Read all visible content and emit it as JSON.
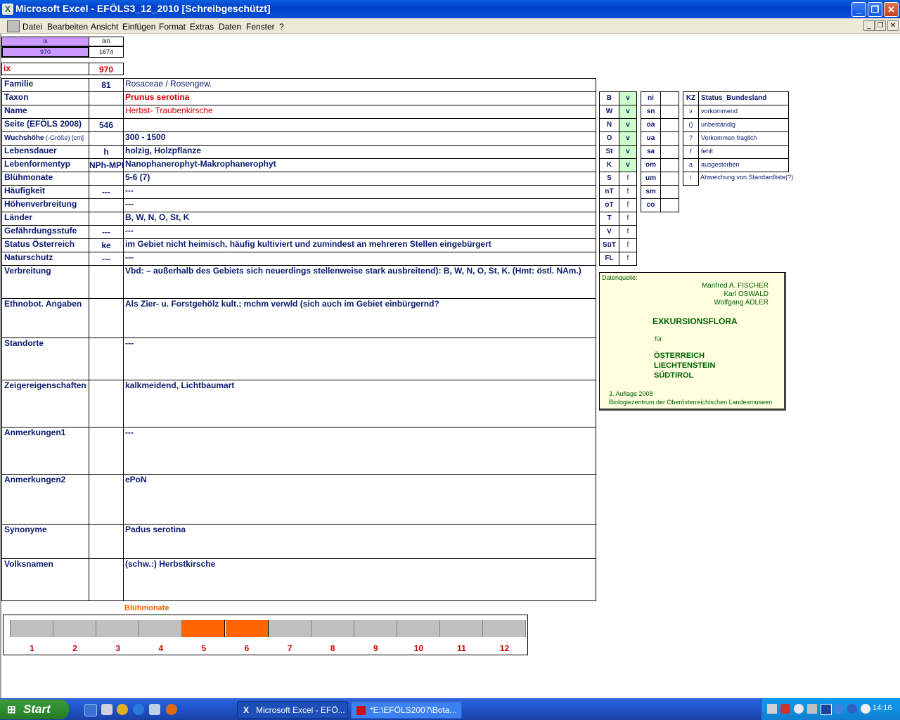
{
  "window": {
    "title": "Microsoft Excel - EFÖLS3_12_2010  [Schreibgeschützt]"
  },
  "menu": [
    "Datei",
    "Bearbeiten",
    "Ansicht",
    "Einfügen",
    "Format",
    "Extras",
    "Daten",
    "Fenster",
    "?"
  ],
  "top": {
    "hdr1": "ix",
    "hdr2": "ixn",
    "v1": "970",
    "v2": "1674",
    "ix_label": "ix",
    "ix_value": "970"
  },
  "rows": [
    {
      "label": "Familie",
      "code": "81",
      "value": "Rosaceae  /  Rosengew."
    },
    {
      "label": "Taxon",
      "code": "",
      "value": "Prunus serotina"
    },
    {
      "label": "Name",
      "code": "",
      "value": "Herbst- Traubenkirsche"
    },
    {
      "label": "Seite (EFÖLS 2008)",
      "code": "546",
      "value": ""
    },
    {
      "label": "Wuchshöhe",
      "label_suffix": "(-Größe) [cm]",
      "code": "",
      "value": " 300 - 1500"
    },
    {
      "label": "Lebensdauer",
      "code": "h",
      "value": "holzig, Holzpflanze"
    },
    {
      "label": "Lebenformentyp",
      "code": "NPh-MPh",
      "value": "Nanophanerophyt-Makrophanerophyt"
    },
    {
      "label": "Blühmonate",
      "code": "",
      "value": " 5-6 (7)"
    },
    {
      "label": "Häufigkeit",
      "code": "---",
      "value": " ---"
    },
    {
      "label": "Höhenverbreitung",
      "code": "",
      "value": " ---"
    },
    {
      "label": "Länder",
      "code": "",
      "value": "B, W, N, O, St, K"
    },
    {
      "label": "Gefährdungsstufe",
      "code": "---",
      "value": "   ---"
    },
    {
      "label": "Status Österreich",
      "code": "ke",
      "value": "im Gebiet nicht heimisch, häufig kultiviert und zumindest an mehreren Stellen eingebürgert"
    },
    {
      "label": "Naturschutz",
      "code": "---",
      "value": " ---"
    },
    {
      "label": "Verbreitung",
      "code": "",
      "value": "Vbd: – außerhalb des Gebiets sich neuerdings stellenweise stark ausbreitend): B, W, N, O, St, K. (Hmt: östl. NAm.)"
    },
    {
      "label": "Ethnobot. Angaben",
      "code": "",
      "value": "Als Zier- u. Forstgehölz kult.; mchm verwld (sich auch im Gebiet einbürgernd?"
    },
    {
      "label": "Standorte",
      "code": "",
      "value": "---"
    },
    {
      "label": "Zeigereigenschaften",
      "code": "",
      "value": "kalkmeidend, Lichtbaumart"
    },
    {
      "label": "Anmerkungen1",
      "code": "",
      "value": "---"
    },
    {
      "label": "Anmerkungen2",
      "code": "",
      "value": "ePoN"
    },
    {
      "label": "Synonyme",
      "code": "",
      "value": "Padus serotina"
    },
    {
      "label": "Volksnamen",
      "code": "",
      "value": "(schw.:) Herbstkirsche"
    }
  ],
  "bundeslaender": [
    {
      "k": "B",
      "v": "v"
    },
    {
      "k": "W",
      "v": "v"
    },
    {
      "k": "N",
      "v": "v"
    },
    {
      "k": "O",
      "v": "v"
    },
    {
      "k": "St",
      "v": "v"
    },
    {
      "k": "K",
      "v": "v"
    },
    {
      "k": "S",
      "v": "f"
    },
    {
      "k": "nT",
      "v": "f"
    },
    {
      "k": "oT",
      "v": "f"
    },
    {
      "k": "T",
      "v": "f"
    },
    {
      "k": "V",
      "v": "f"
    },
    {
      "k": "SüT",
      "v": "f"
    },
    {
      "k": "FL",
      "v": "f"
    }
  ],
  "extra_codes": [
    "ni",
    "sn",
    "oa",
    "ua",
    "sa",
    "om",
    "um",
    "sm",
    "co"
  ],
  "legend": {
    "kz_header": "KZ",
    "status_header": "Status_Bundesland",
    "items": [
      {
        "kz": "v",
        "text": "vorkommend"
      },
      {
        "kz": "()",
        "text": "unbeständig"
      },
      {
        "kz": "?",
        "text": "Vorkommen fraglich"
      },
      {
        "kz": "f",
        "text": "fehlt"
      },
      {
        "kz": "a",
        "text": "ausgestorben"
      },
      {
        "kz": "!",
        "text": "Abweichung von Standardliste(?)"
      }
    ]
  },
  "source": {
    "label": "Datenquelle:",
    "author1": "Manfred A. FISCHER",
    "author2": "Karl OSWALD",
    "author3": "Wolfgang ADLER",
    "book": "EXKURSIONSFLORA",
    "fuer": "für",
    "c1": "ÖSTERREICH",
    "c2": "LIECHTENSTEIN",
    "c3": "SÜDTIROL",
    "edition": "3. Auflage 2008",
    "publisher": "Biologiezentrum der Oberösterreichischen Landesmuseen"
  },
  "chart_data": {
    "type": "bar",
    "title": "Blühmonate",
    "categories": [
      "1",
      "2",
      "3",
      "4",
      "5",
      "6",
      "7",
      "8",
      "9",
      "10",
      "11",
      "12"
    ],
    "values": [
      0,
      0,
      0,
      0,
      1,
      1,
      0,
      0,
      0,
      0,
      0,
      0
    ],
    "colors": {
      "on": "#ff6600",
      "off": "#c0c0c0"
    }
  },
  "taskbar": {
    "start": "Start",
    "tasks": [
      "Microsoft Excel - EFÖ...",
      "*E:\\EFÖLS2007\\Bota..."
    ],
    "clock": "14:16"
  }
}
